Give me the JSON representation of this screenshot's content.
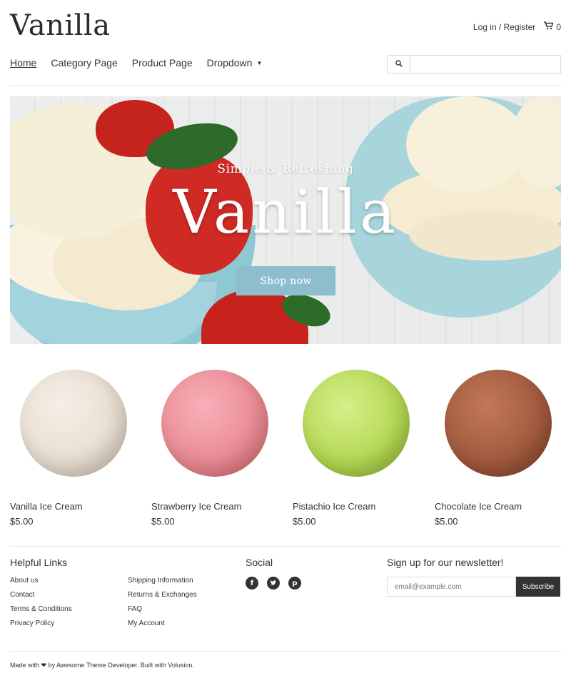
{
  "header": {
    "logo": "Vanilla",
    "account_link": "Log in / Register",
    "cart_count": "0"
  },
  "nav": {
    "items": [
      "Home",
      "Category Page",
      "Product Page",
      "Dropdown"
    ],
    "active": "Home"
  },
  "search": {
    "placeholder": ""
  },
  "hero": {
    "subtitle": "Simple & Refreshing",
    "title": "Vanilla",
    "cta": "Shop now"
  },
  "products": [
    {
      "name": "Vanilla Ice Cream",
      "price": "$5.00",
      "color": "#ece2d6"
    },
    {
      "name": "Strawberry Ice Cream",
      "price": "$5.00",
      "color": "#ea8a94"
    },
    {
      "name": "Pistachio Ice Cream",
      "price": "$5.00",
      "color": "#b3d851"
    },
    {
      "name": "Chocolate Ice Cream",
      "price": "$5.00",
      "color": "#a25a3e"
    }
  ],
  "footer": {
    "helpful_links_title": "Helpful Links",
    "links_col1": [
      "About us",
      "Contact",
      "Terms & Conditions",
      "Privacy Policy"
    ],
    "links_col2": [
      "Shipping Information",
      "Returns & Exchanges",
      "FAQ",
      "My Account"
    ],
    "social_title": "Social",
    "social_icons": [
      "facebook-icon",
      "twitter-icon",
      "pinterest-icon"
    ],
    "newsletter_title": "Sign up for our newsletter!",
    "newsletter_placeholder": "email@example.com",
    "subscribe_label": "Subscribe",
    "credit": "Made with ❤ by Awesome Theme Developer. Built with Volusion."
  },
  "colors": {
    "accent": "#8ebecd",
    "dark": "#333333"
  }
}
